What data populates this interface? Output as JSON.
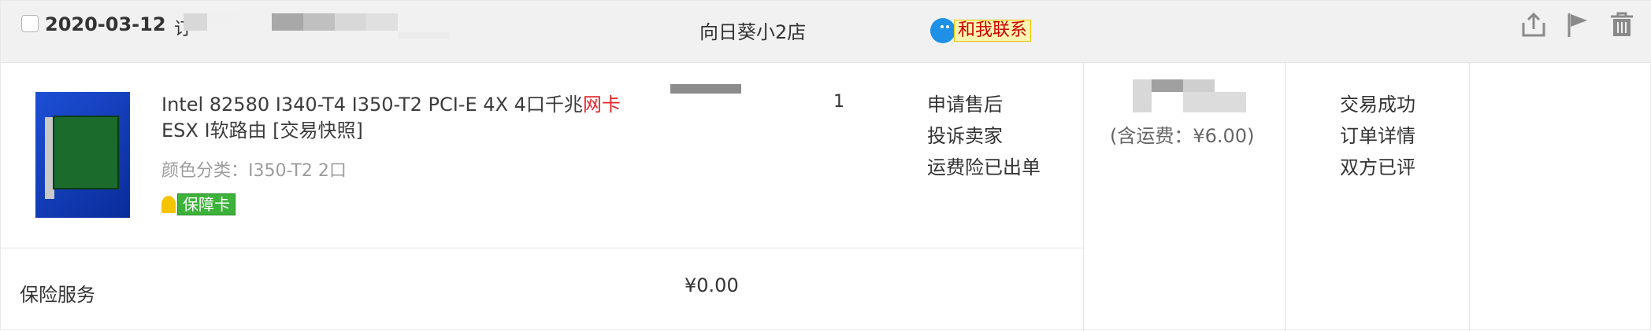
{
  "header": {
    "date": "2020-03-12",
    "order_number_label": "订",
    "shop_name": "向日葵小2店",
    "contact_label": "和我联系",
    "icons": [
      "share-icon",
      "flag-icon",
      "trash-icon"
    ]
  },
  "item": {
    "title_part1": "Intel 82580 I340-T4 I350-T2 PCI-E 4X 4口千兆",
    "title_highlight": "网卡",
    "title_part2": " ESX I软路由 [交易快照]",
    "spec": "颜色分类：I350-T2 2口",
    "guarantee_label": "保障卡",
    "quantity": "1",
    "actions": [
      "申请售后",
      "投诉卖家",
      "运费险已出单"
    ]
  },
  "total": {
    "shipping_note": "(含运费：¥6.00)"
  },
  "status": {
    "lines": [
      "交易成功",
      "订单详情",
      "双方已评"
    ]
  },
  "insurance": {
    "label": "保险服务",
    "price": "¥0.00"
  },
  "colors": {
    "header_bg": "#f1f1f1",
    "highlight_red": "#e4252c",
    "guarantee_green": "#3db23a",
    "contact_blue": "#1e90e6"
  }
}
